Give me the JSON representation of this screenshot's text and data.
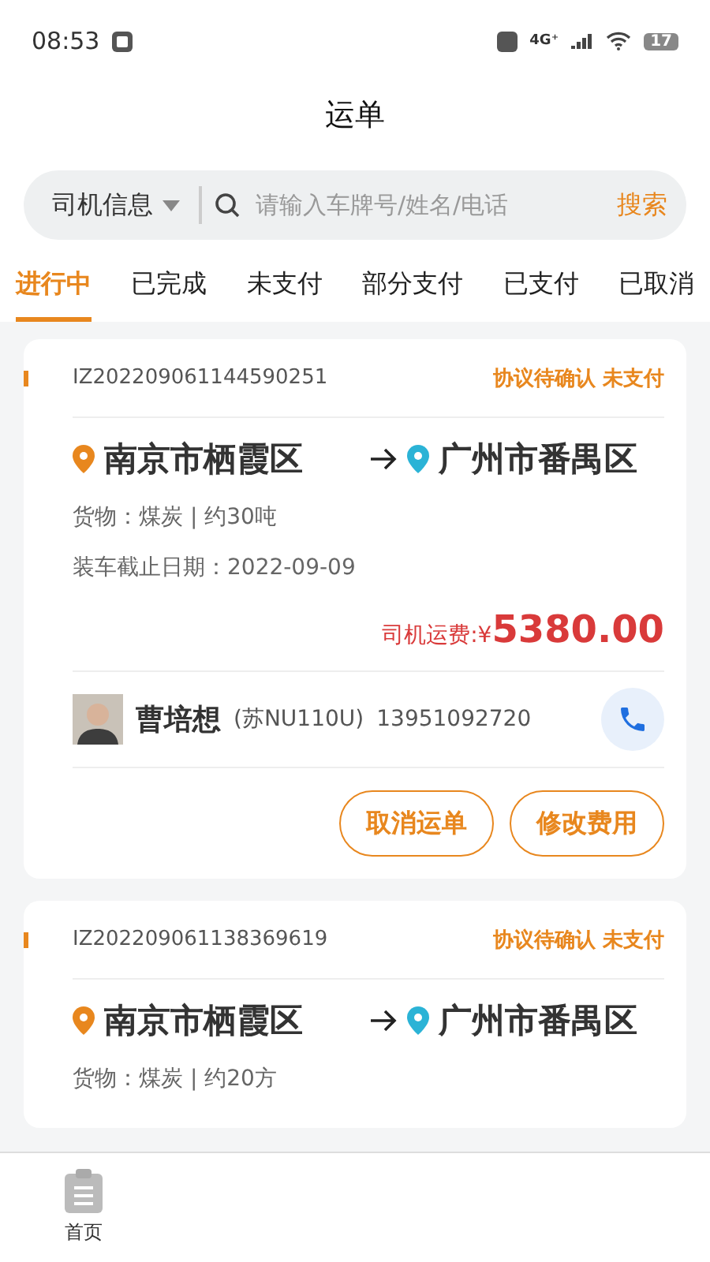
{
  "status_bar": {
    "time": "08:53",
    "battery": "17",
    "network": "4G⁺"
  },
  "title": "运单",
  "search": {
    "filter": "司机信息",
    "placeholder": "请输入车牌号/姓名/电话",
    "action": "搜索"
  },
  "tabs": [
    {
      "label": "进行中",
      "selected": true
    },
    {
      "label": "已完成",
      "selected": false
    },
    {
      "label": "未支付",
      "selected": false
    },
    {
      "label": "部分支付",
      "selected": false
    },
    {
      "label": "已支付",
      "selected": false
    },
    {
      "label": "已取消",
      "selected": false
    }
  ],
  "orders": [
    {
      "number": "IZ202209061144590251",
      "status": "协议待确认 未支付",
      "from": "南京市栖霞区",
      "to": "广州市番禺区",
      "cargo": "货物：煤炭 | 约30吨",
      "deadline": "装车截止日期：2022-09-09",
      "fee_label": "司机运费:¥",
      "fee": "5380.00",
      "driver": "曹培想",
      "plate": "(苏NU110U)",
      "phone": "13951092720",
      "buttons": [
        "取消运单",
        "修改费用"
      ]
    },
    {
      "number": "IZ202209061138369619",
      "status": "协议待确认 未支付",
      "from": "南京市栖霞区",
      "to": "广州市番禺区",
      "cargo": "货物：煤炭 | 约20方"
    }
  ],
  "nav": [
    {
      "label": "首页",
      "selected": false
    }
  ]
}
